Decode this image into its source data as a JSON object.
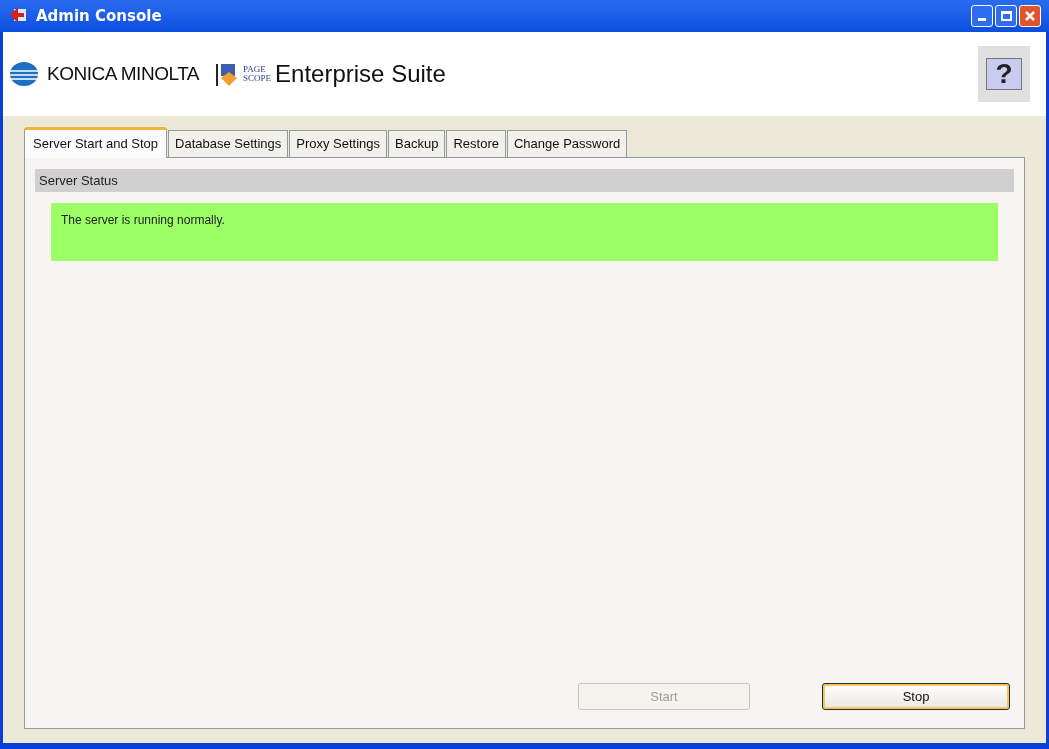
{
  "window": {
    "title": "Admin Console"
  },
  "header": {
    "brand": "KONICA MINOLTA",
    "product_mark_top": "PAGE",
    "product_mark_bottom": "SCOPE",
    "product": "Enterprise Suite",
    "help": "?"
  },
  "tabs": [
    {
      "label": "Server Start and Stop",
      "selected": true
    },
    {
      "label": "Database Settings",
      "selected": false
    },
    {
      "label": "Proxy Settings",
      "selected": false
    },
    {
      "label": "Backup",
      "selected": false
    },
    {
      "label": "Restore",
      "selected": false
    },
    {
      "label": "Change Password",
      "selected": false
    }
  ],
  "section": {
    "title": "Server Status",
    "message": "The server is running normally.",
    "color": "#9cff66"
  },
  "buttons": [
    {
      "label": "Start",
      "disabled": true,
      "focused": false
    },
    {
      "label": "Stop",
      "disabled": false,
      "focused": true
    }
  ]
}
